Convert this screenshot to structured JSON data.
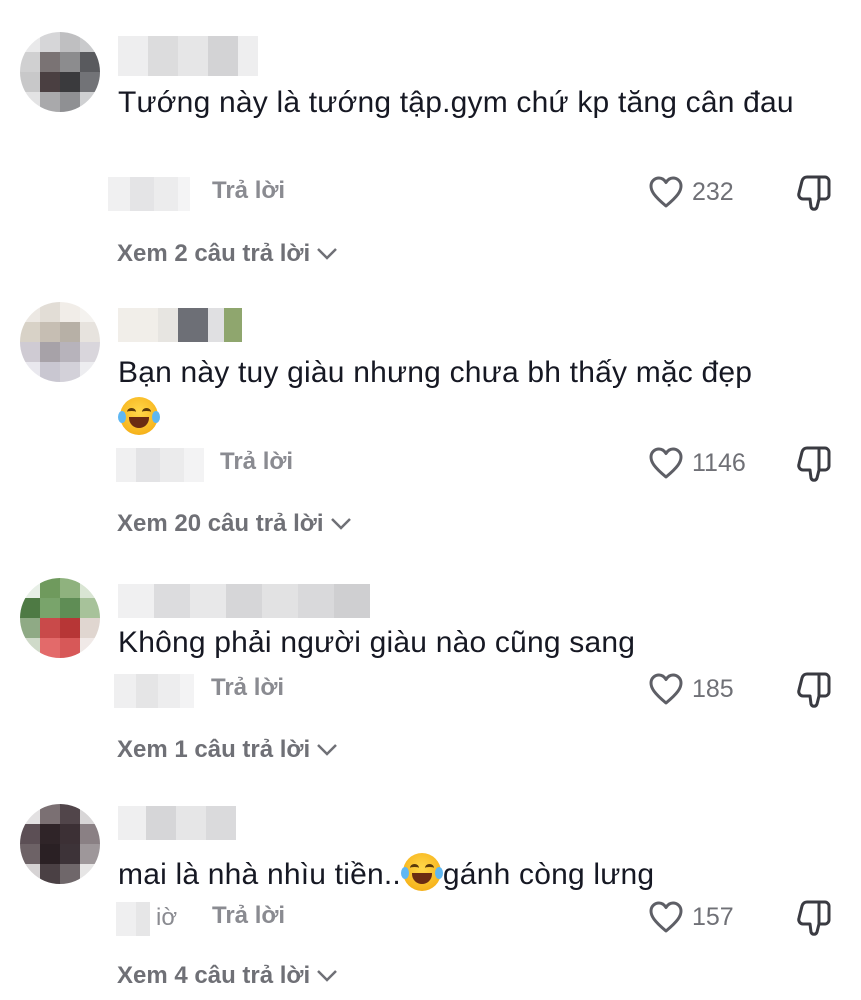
{
  "comments": [
    {
      "text": "Tướng này là tướng tập.gym chứ kp tăng cân đau",
      "emoji_after": false,
      "date_tail": "",
      "reply_label": "Trả lời",
      "likes": "232",
      "view_replies": "Xem 2 câu trả lời"
    },
    {
      "text": "Bạn này tuy giàu nhưng chưa bh thấy mặc đẹp",
      "emoji_after": true,
      "date_tail": "",
      "reply_label": "Trả lời",
      "likes": "1146",
      "view_replies": "Xem 20 câu trả lời"
    },
    {
      "text": "Không phải người giàu nào cũng sang",
      "emoji_after": false,
      "date_tail": "",
      "reply_label": "Trả lời",
      "likes": "185",
      "view_replies": "Xem 1 câu trả lời"
    },
    {
      "text_before": "mai là nhà nhìu tiền..",
      "text_after": "gánh còng lưng",
      "date_tail": "iờ",
      "reply_label": "Trả lời",
      "likes": "157",
      "view_replies": "Xem 4 câu trả lời"
    }
  ],
  "icons": {
    "like": "heart-outline-icon",
    "dislike": "thumbs-down-outline-icon",
    "expand": "chevron-down-icon",
    "emoji": "face-with-tears-of-joy"
  },
  "colors": {
    "text": "#161823",
    "muted": "#8a8b91",
    "icon": "#5e5f66"
  }
}
